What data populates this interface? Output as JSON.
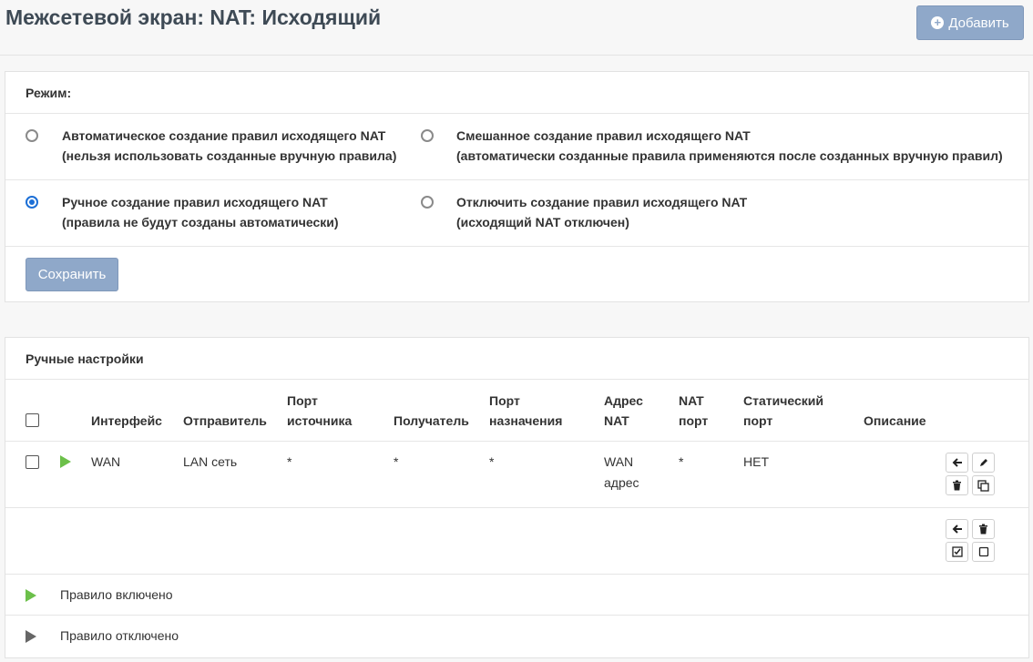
{
  "header": {
    "title": "Межсетевой экран: NAT: Исходящий",
    "add_button": "Добавить"
  },
  "mode": {
    "title": "Режим:",
    "options": [
      {
        "line1": "Автоматическое создание правил исходящего NAT",
        "line2": "(нельзя использовать созданные вручную правила)",
        "checked": false
      },
      {
        "line1": "Смешанное создание правил исходящего NAT",
        "line2": "(автоматически созданные правила применяются после созданных вручную правил)",
        "checked": false
      },
      {
        "line1": "Ручное создание правил исходящего NAT",
        "line2": "(правила не будут созданы автоматически)",
        "checked": true
      },
      {
        "line1": "Отключить создание правил исходящего NAT",
        "line2": "(исходящий NAT отключен)",
        "checked": false
      }
    ],
    "save_button": "Сохранить"
  },
  "manual": {
    "title": "Ручные настройки",
    "columns": {
      "interface": "Интерфейс",
      "source": "Отправитель",
      "source_port_1": "Порт",
      "source_port_2": "источника",
      "destination": "Получатель",
      "dest_port_1": "Порт",
      "dest_port_2": "назначения",
      "nat_address_1": "Адрес",
      "nat_address_2": "NAT",
      "nat_port_1": "NAT",
      "nat_port_2": "порт",
      "static_port_1": "Статический",
      "static_port_2": "порт",
      "description": "Описание"
    },
    "rows": [
      {
        "interface": "WAN",
        "source": "LAN сеть",
        "source_port": "*",
        "destination": "*",
        "dest_port": "*",
        "nat_address_1": "WAN",
        "nat_address_2": "адрес",
        "nat_port": "*",
        "static_port": "НЕТ",
        "description": ""
      }
    ],
    "legend": {
      "enabled": "Правило включено",
      "disabled": "Правило отключено"
    }
  },
  "colors": {
    "accent": "#8fa8c9",
    "radio_checked": "#1c6fd6",
    "enabled": "#6cc04a",
    "disabled": "#666666"
  },
  "icons": {
    "add": "plus-circle-icon",
    "move": "arrow-left-icon",
    "edit": "pencil-icon",
    "delete": "trash-icon",
    "clone": "clone-icon",
    "enable_all": "check-square-icon",
    "disable_all": "empty-square-icon"
  }
}
